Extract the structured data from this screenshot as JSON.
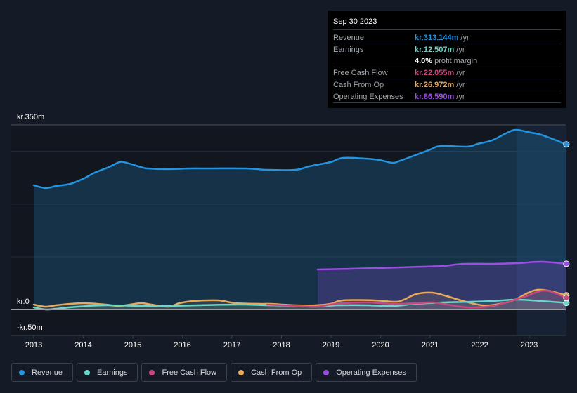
{
  "tooltip": {
    "date": "Sep 30 2023",
    "rows": [
      {
        "label": "Revenue",
        "value": "kr.313.144m",
        "unit": "/yr",
        "color": "#2394df"
      },
      {
        "label": "Earnings",
        "value": "kr.12.507m",
        "unit": "/yr",
        "color": "#6ad8c8"
      },
      {
        "label": "",
        "value": "4.0%",
        "unit": "profit margin",
        "color": "#ffffff"
      },
      {
        "label": "Free Cash Flow",
        "value": "kr.22.055m",
        "unit": "/yr",
        "color": "#c9477e"
      },
      {
        "label": "Cash From Op",
        "value": "kr.26.972m",
        "unit": "/yr",
        "color": "#e8a95b"
      },
      {
        "label": "Operating Expenses",
        "value": "kr.86.590m",
        "unit": "/yr",
        "color": "#9b4fe0"
      }
    ]
  },
  "legend": [
    {
      "label": "Revenue",
      "color": "#2394df"
    },
    {
      "label": "Earnings",
      "color": "#6ad8c8"
    },
    {
      "label": "Free Cash Flow",
      "color": "#c9477e"
    },
    {
      "label": "Cash From Op",
      "color": "#e8a95b"
    },
    {
      "label": "Operating Expenses",
      "color": "#9b4fe0"
    }
  ],
  "chart_data": {
    "type": "area",
    "title": "",
    "xlabel": "",
    "ylabel": "",
    "y_tick_labels": [
      "kr.350m",
      "kr.0",
      "-kr.50m"
    ],
    "ylim": [
      -50,
      350
    ],
    "xlim": [
      2012.55,
      2023.75
    ],
    "x_ticks": [
      2013,
      2014,
      2015,
      2016,
      2017,
      2018,
      2019,
      2020,
      2021,
      2022,
      2023
    ],
    "x_tick_labels": [
      "2013",
      "2014",
      "2015",
      "2016",
      "2017",
      "2018",
      "2019",
      "2020",
      "2021",
      "2022",
      "2023"
    ],
    "gridlines_y": [
      100,
      200,
      300
    ],
    "highlight_range": [
      2022.75,
      2023.75
    ],
    "grid": true,
    "legend_position": "bottom",
    "series": [
      {
        "name": "Revenue",
        "color": "#2394df",
        "unit": "kr.m",
        "x": [
          2013.0,
          2013.24,
          2013.45,
          2013.74,
          2014.02,
          2014.23,
          2014.52,
          2014.73,
          2014.87,
          2015.16,
          2015.3,
          2015.72,
          2016.15,
          2016.57,
          2017.28,
          2017.71,
          2018.28,
          2018.56,
          2018.99,
          2019.24,
          2019.7,
          2019.98,
          2020.23,
          2020.4,
          2020.97,
          2021.21,
          2021.75,
          2021.96,
          2022.25,
          2022.53,
          2022.73,
          2023.03,
          2023.24,
          2023.75
        ],
        "values": [
          235.6,
          230.2,
          234.2,
          238.2,
          248.9,
          259.5,
          270.2,
          279.5,
          278.2,
          270.2,
          267.5,
          266.2,
          267.5,
          267.5,
          267.5,
          264.8,
          264.8,
          271.5,
          279.5,
          287.5,
          286.1,
          283.5,
          278.2,
          282.2,
          302.1,
          310.1,
          308.8,
          314.1,
          320.8,
          334.0,
          340.7,
          335.4,
          331.4,
          313.144
        ]
      },
      {
        "name": "Earnings",
        "color": "#6ad8c8",
        "unit": "kr.m",
        "x": [
          2013.0,
          2013.24,
          2013.45,
          2013.88,
          2014.45,
          2015.16,
          2015.72,
          2016.29,
          2017.14,
          2017.71,
          2018.28,
          2018.7,
          2019.13,
          2019.7,
          2020.26,
          2020.69,
          2021.26,
          2021.83,
          2022.25,
          2022.75,
          2023.24,
          2023.75
        ],
        "values": [
          4.0,
          0.0,
          1.3,
          5.3,
          8.0,
          6.7,
          6.7,
          8.0,
          9.3,
          8.0,
          6.7,
          5.3,
          8.0,
          8.0,
          6.7,
          10.6,
          13.3,
          14.6,
          16.0,
          18.6,
          16.0,
          12.507
        ]
      },
      {
        "name": "Free Cash Flow",
        "color": "#c9477e",
        "unit": "kr.m",
        "x": [
          2017.71,
          2018.28,
          2018.7,
          2018.99,
          2019.24,
          2019.74,
          2020.31,
          2020.74,
          2021.06,
          2021.34,
          2021.77,
          2022.27,
          2022.62,
          2022.9,
          2023.32,
          2023.75
        ],
        "values": [
          9.3,
          6.7,
          5.3,
          9.3,
          12.0,
          13.3,
          10.6,
          12.0,
          13.3,
          9.3,
          4.0,
          6.7,
          16.0,
          24.0,
          35.9,
          22.055
        ]
      },
      {
        "name": "Cash From Op",
        "color": "#e8a95b",
        "unit": "kr.m",
        "x": [
          2013.0,
          2013.24,
          2013.45,
          2013.74,
          2014.02,
          2014.45,
          2014.73,
          2015.16,
          2015.37,
          2015.72,
          2015.94,
          2016.22,
          2016.72,
          2017.07,
          2017.57,
          2017.78,
          2018.28,
          2018.7,
          2018.99,
          2019.24,
          2019.87,
          2020.3,
          2020.47,
          2020.72,
          2021.04,
          2021.34,
          2021.62,
          2022.04,
          2022.33,
          2022.68,
          2023.17,
          2023.75
        ],
        "values": [
          9.3,
          5.3,
          8.0,
          10.6,
          12.0,
          9.3,
          6.7,
          12.0,
          9.3,
          5.3,
          12.0,
          16.0,
          17.3,
          12.0,
          10.6,
          10.6,
          8.0,
          8.0,
          10.6,
          17.3,
          17.3,
          14.6,
          18.6,
          29.3,
          31.9,
          25.3,
          17.3,
          8.0,
          9.3,
          17.3,
          37.3,
          26.972
        ]
      },
      {
        "name": "Operating Expenses",
        "color": "#9b4fe0",
        "unit": "kr.m",
        "x": [
          2018.73,
          2019.41,
          2020.4,
          2020.83,
          2021.26,
          2021.68,
          2022.25,
          2022.75,
          2023.24,
          2023.75
        ],
        "values": [
          75.9,
          77.2,
          79.8,
          81.2,
          82.5,
          86.5,
          86.5,
          87.8,
          90.5,
          86.59
        ]
      }
    ]
  }
}
